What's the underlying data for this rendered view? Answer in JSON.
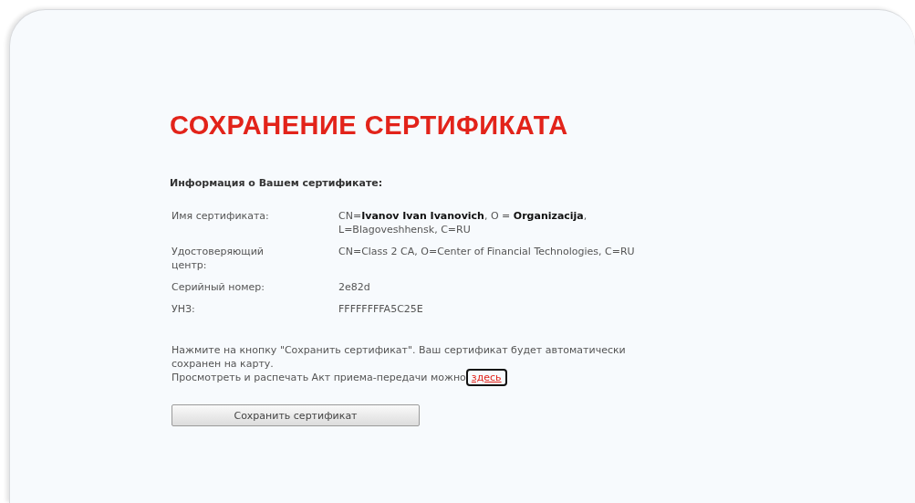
{
  "title": "СОХРАНЕНИЕ СЕРТИФИКАТА",
  "section_heading": "Информация о Вашем сертификате:",
  "fields": [
    {
      "label": "Имя сертификата:",
      "lines": [
        "CN=**Ivanov Ivan Ivanovich**, O = **Organizacija**,",
        "L=Blagoveshhensk, C=RU"
      ]
    },
    {
      "label": "Удостоверяющий центр:",
      "lines": [
        "CN=Class 2 CA, O=Center of Financial Technologies, C=RU"
      ]
    },
    {
      "label": "Серийный номер:",
      "lines": [
        "2e82d"
      ]
    },
    {
      "label": "УНЗ:",
      "lines": [
        "FFFFFFFFA5C25E"
      ]
    }
  ],
  "instructions": "Нажмите на кнопку \"Сохранить сертификат\". Ваш сертификат будет автоматически сохранен на карту.",
  "act_text": "Просмотреть и распечать Акт приема-передачи можно",
  "act_link": {
    "label": "здесь",
    "highlighted": true
  },
  "save_button": "Сохранить сертификат"
}
